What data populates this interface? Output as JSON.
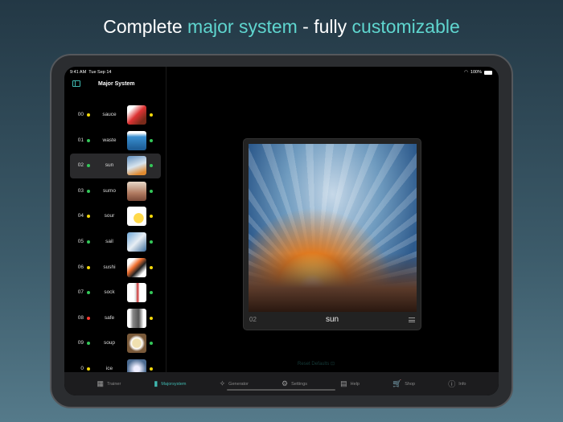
{
  "headline": {
    "pre": "Complete ",
    "accent1": "major system",
    "mid": " - fully ",
    "accent2": "customizable"
  },
  "status": {
    "time": "9:41 AM",
    "date": "Tue Sep 14",
    "battery": "100%"
  },
  "sidebar": {
    "title": "Major System",
    "items": [
      {
        "num": "00",
        "word": "sauce",
        "c1": "#f5d90a",
        "c2": "#f5d90a",
        "thumb": "linear-gradient(135deg,#fff 20%,#d33 50%,#7a2a1a 80%)"
      },
      {
        "num": "01",
        "word": "waste",
        "c1": "#34c759",
        "c2": "#34c759",
        "thumb": "linear-gradient(180deg,#fff 10%,#3a8fd0 30%,#1f5f99 90%)"
      },
      {
        "num": "02",
        "word": "sun",
        "c1": "#34c759",
        "c2": "#34c759",
        "thumb": "linear-gradient(160deg,#5f8fbf,#d7e4ee 50%,#e08a30 85%)"
      },
      {
        "num": "03",
        "word": "sumo",
        "c1": "#34c759",
        "c2": "#34c759",
        "thumb": "linear-gradient(180deg,#e8d8c8,#b07a60 60%,#7a4a38)"
      },
      {
        "num": "04",
        "word": "sour",
        "c1": "#f5d90a",
        "c2": "#f5d90a",
        "thumb": "radial-gradient(circle at 60% 60%,#ffd94a 30%,#fff 32%)"
      },
      {
        "num": "05",
        "word": "sail",
        "c1": "#34c759",
        "c2": "#34c759",
        "thumb": "linear-gradient(135deg,#6fa8d8,#e8eef4 50%,#3a6a9a)"
      },
      {
        "num": "06",
        "word": "sushi",
        "c1": "#f5d90a",
        "c2": "#f5d90a",
        "thumb": "linear-gradient(135deg,#fff 20%,#f07030 40%,#222 60%,#fff 80%)"
      },
      {
        "num": "07",
        "word": "sock",
        "c1": "#34c759",
        "c2": "#34c759",
        "thumb": "linear-gradient(90deg,#fff 35%,#ddd 45%,#c33 55%,#fff 65%)"
      },
      {
        "num": "08",
        "word": "safe",
        "c1": "#ff3b30",
        "c2": "#f5d90a",
        "thumb": "linear-gradient(90deg,#fff 15%,#888 30%,#555 60%,#fff 85%)"
      },
      {
        "num": "09",
        "word": "soup",
        "c1": "#34c759",
        "c2": "#34c759",
        "thumb": "radial-gradient(circle,#f0e0b0 30%,#fff 40%,#7a5a3a 60%)"
      },
      {
        "num": "0",
        "word": "ice",
        "c1": "#f5d90a",
        "c2": "#f5d90a",
        "thumb": "radial-gradient(circle,#eef 20%,#4a6a90 70%)"
      }
    ]
  },
  "detail": {
    "num": "02",
    "word": "sun"
  },
  "reset_label": "Reset Defaults",
  "tabs": [
    {
      "label": "Trainer",
      "icon": "▦"
    },
    {
      "label": "Majorsystem",
      "icon": "▮",
      "active": true
    },
    {
      "label": "Generator",
      "icon": "✧"
    },
    {
      "label": "Settings",
      "icon": "⚙"
    },
    {
      "label": "Help",
      "icon": "▤"
    },
    {
      "label": "Shop",
      "icon": "🛒"
    },
    {
      "label": "Info",
      "icon": "ⓘ"
    }
  ]
}
